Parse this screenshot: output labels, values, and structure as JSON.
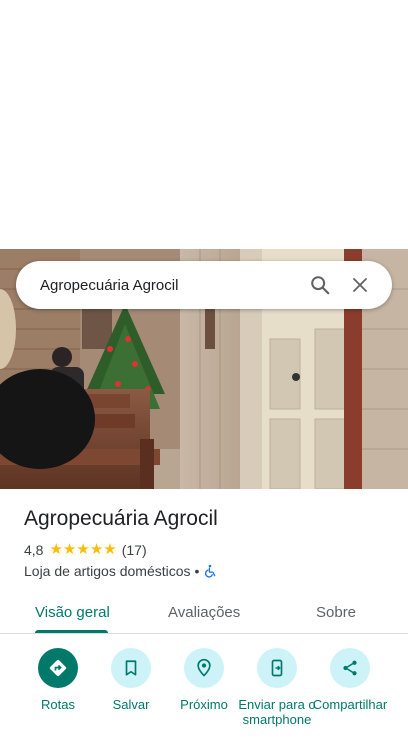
{
  "search": {
    "query": "Agropecuária Agrocil"
  },
  "place": {
    "name": "Agropecuária Agrocil",
    "rating": "4,8",
    "stars": 5,
    "review_count": "(17)",
    "category": "Loja de artigos domésticos",
    "separator": "•",
    "accessibility": "wheelchair-icon"
  },
  "tabs": [
    {
      "label": "Visão geral",
      "active": true
    },
    {
      "label": "Avaliações",
      "active": false
    },
    {
      "label": "Sobre",
      "active": false
    }
  ],
  "actions": [
    {
      "label": "Rotas",
      "icon": "directions-icon"
    },
    {
      "label": "Salvar",
      "icon": "bookmark-icon"
    },
    {
      "label": "Próximo",
      "icon": "nearby-icon"
    },
    {
      "label": "Enviar para o smartphone",
      "icon": "send-to-phone-icon"
    },
    {
      "label": "Compartilhar",
      "icon": "share-icon"
    }
  ],
  "colors": {
    "accent": "#00796b",
    "action_bg": "#cdf3f8",
    "star": "#fbbc04",
    "accessibility": "#1a73e8"
  }
}
